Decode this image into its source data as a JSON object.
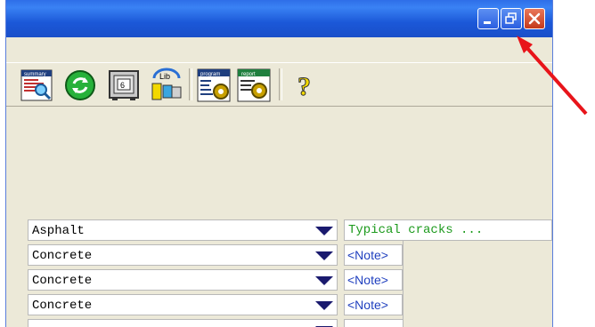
{
  "window": {
    "title": "",
    "controls": {
      "minimize_icon": "minimize-icon",
      "restore_icon": "restore-icon",
      "close_icon": "close-icon"
    }
  },
  "toolbar": {
    "tools": [
      {
        "name": "summary-report",
        "caption": "summary"
      },
      {
        "name": "refresh",
        "caption": ""
      },
      {
        "name": "safe",
        "caption": ""
      },
      {
        "name": "library",
        "caption": "Lib"
      },
      {
        "name": "program",
        "caption": "program"
      },
      {
        "name": "report-settings",
        "caption": "report"
      },
      {
        "name": "help",
        "caption": "?"
      }
    ]
  },
  "rows": [
    {
      "material": "Asphalt"
    },
    {
      "material": "Concrete",
      "note": "<Note>"
    },
    {
      "material": "Concrete",
      "note": "<Note>"
    },
    {
      "material": "Concrete",
      "note": "<Note>"
    },
    {
      "material": ""
    }
  ],
  "comment": "Typical cracks ...",
  "colors": {
    "accent_arrow": "#e8141a",
    "comment_text": "#1c9a1c",
    "note_text": "#1f3fbf"
  }
}
